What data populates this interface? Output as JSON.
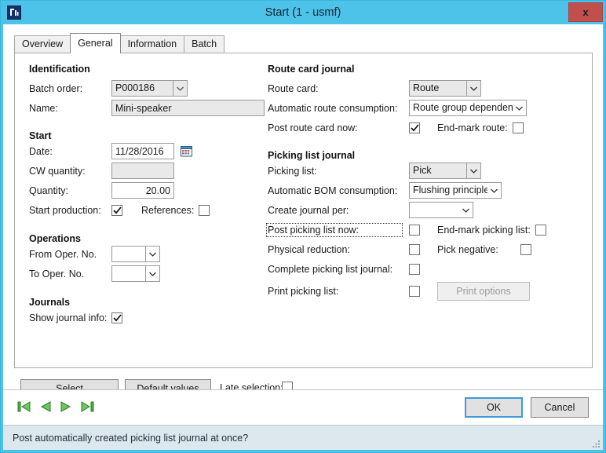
{
  "window": {
    "title": "Start (1 - usmf)",
    "app_icon": "dynamics-app-icon",
    "close_label": "x",
    "titlebar_color": "#4ec3ea",
    "close_color": "#c1504d"
  },
  "tabs": [
    {
      "label": "Overview",
      "selected": false
    },
    {
      "label": "General",
      "selected": true
    },
    {
      "label": "Information",
      "selected": false
    },
    {
      "label": "Batch",
      "selected": false
    }
  ],
  "left": {
    "identification": {
      "title": "Identification",
      "batch_order": {
        "label": "Batch order:",
        "value": "P000186"
      },
      "name": {
        "label": "Name:",
        "value": "Mini-speaker"
      }
    },
    "start": {
      "title": "Start",
      "date": {
        "label": "Date:",
        "value": "11/28/2016",
        "icon": "calendar-icon"
      },
      "cw_quantity": {
        "label": "CW quantity:",
        "value": ""
      },
      "quantity": {
        "label": "Quantity:",
        "value": "20.00"
      },
      "start_production": {
        "label": "Start production:",
        "checked": true
      },
      "references": {
        "label": "References:",
        "checked": false
      }
    },
    "operations": {
      "title": "Operations",
      "from_oper": {
        "label": "From Oper. No.",
        "value": ""
      },
      "to_oper": {
        "label": "To Oper. No.",
        "value": ""
      }
    },
    "journals": {
      "title": "Journals",
      "show_journal_info": {
        "label": "Show journal info:",
        "checked": true
      }
    }
  },
  "right": {
    "route_card_journal": {
      "title": "Route card journal",
      "route_card": {
        "label": "Route card:",
        "value": "Route"
      },
      "automatic_route_consumption": {
        "label": "Automatic route consumption:",
        "value": "Route group dependent"
      },
      "post_route_card_now": {
        "label": "Post route card now:",
        "checked": true
      },
      "end_mark_route": {
        "label": "End-mark route:",
        "checked": false
      }
    },
    "picking_list_journal": {
      "title": "Picking list journal",
      "picking_list": {
        "label": "Picking list:",
        "value": "Pick"
      },
      "automatic_bom_consumption": {
        "label": "Automatic BOM consumption:",
        "value": "Flushing principle"
      },
      "create_journal_per": {
        "label": "Create journal per:",
        "value": ""
      },
      "post_picking_list_now": {
        "label": "Post picking list now:",
        "checked": false,
        "focused": true
      },
      "end_mark_picking_list": {
        "label": "End-mark picking list:",
        "checked": false
      },
      "physical_reduction": {
        "label": "Physical reduction:",
        "checked": false
      },
      "pick_negative": {
        "label": "Pick negative:",
        "checked": false
      },
      "complete_picking_list_journal": {
        "label": "Complete picking list journal:",
        "checked": false
      },
      "print_picking_list": {
        "label": "Print picking list:",
        "checked": false
      },
      "print_options": {
        "label": "Print options",
        "disabled": true
      }
    }
  },
  "actions": {
    "select": "Select",
    "default_values": "Default values",
    "late_selection": {
      "label": "Late selection:",
      "checked": false
    }
  },
  "navigation": {
    "first": "first-record-icon",
    "previous": "previous-record-icon",
    "next": "next-record-icon",
    "last": "last-record-icon",
    "arrow_color": "#4caf3f"
  },
  "dialog_buttons": {
    "ok": "OK",
    "cancel": "Cancel",
    "ok_focused": true
  },
  "statusbar": {
    "text": "Post automatically created picking list journal at once?"
  }
}
